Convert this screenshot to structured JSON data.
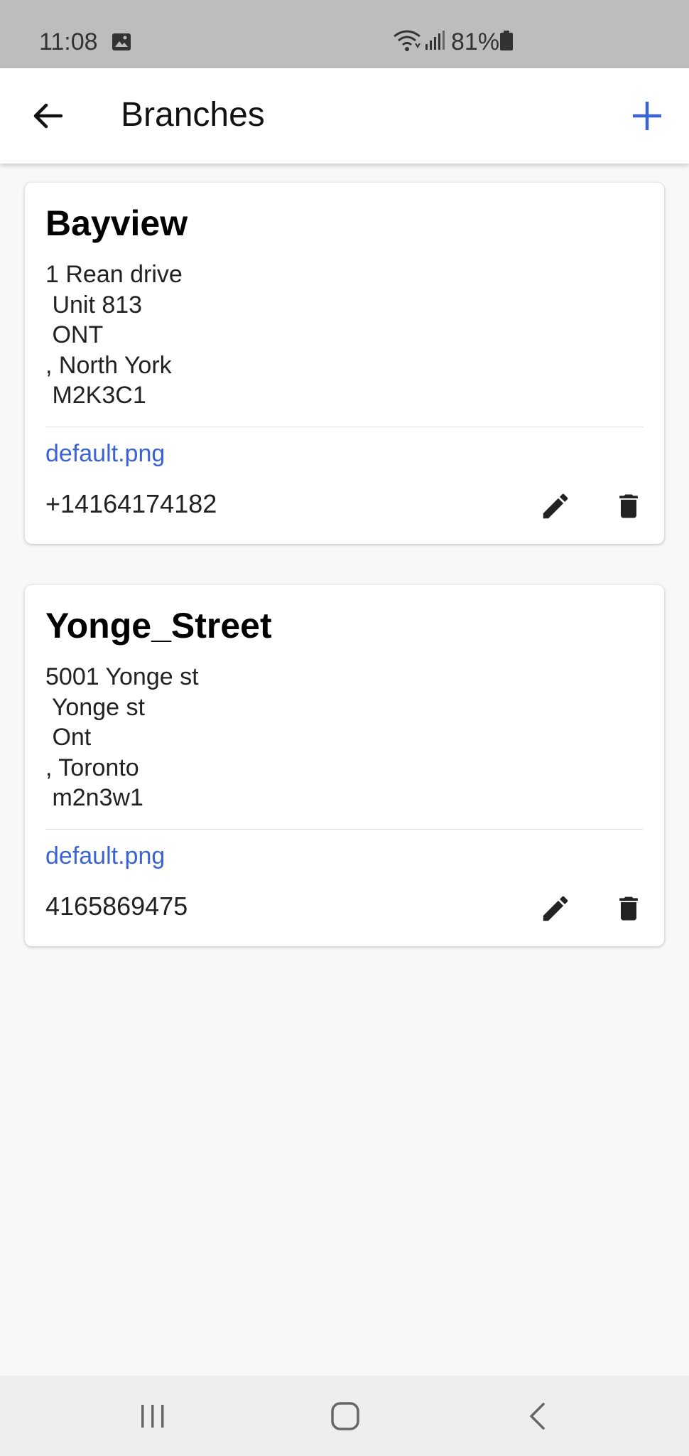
{
  "status_bar": {
    "time": "11:08",
    "battery": "81%",
    "icons": [
      "image-icon",
      "wifi-icon",
      "signal-icon",
      "battery-icon"
    ]
  },
  "app_bar": {
    "title": "Branches",
    "back_icon": "arrow-left-icon",
    "add_icon": "plus-icon",
    "accent_color": "#3a63d6"
  },
  "branches": [
    {
      "name": "Bayview",
      "address": "1 Rean drive\n Unit 813\n ONT\n, North York\n M2K3C1",
      "image": "default.png",
      "phone": "+14164174182"
    },
    {
      "name": "Yonge_Street",
      "address": "5001 Yonge st\n Yonge st\n Ont\n, Toronto\n m2n3w1",
      "image": "default.png",
      "phone": "4165869475"
    }
  ],
  "nav_bar": {
    "icons": [
      "recent-apps-icon",
      "home-icon",
      "back-icon"
    ]
  }
}
